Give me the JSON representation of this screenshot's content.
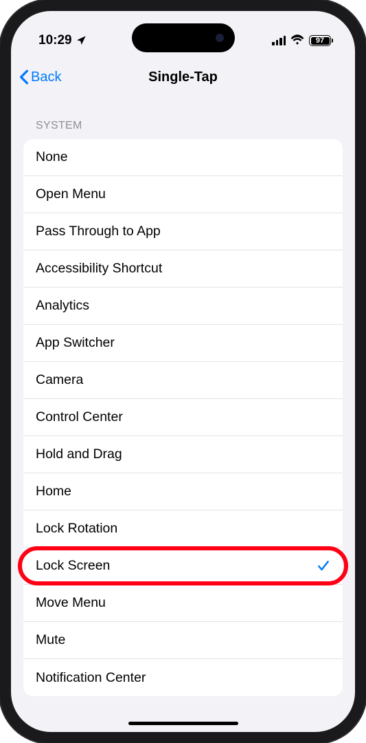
{
  "status_bar": {
    "time": "10:29",
    "battery_percent": "97"
  },
  "nav": {
    "back_label": "Back",
    "title": "Single-Tap"
  },
  "section": {
    "header": "SYSTEM",
    "items": [
      {
        "label": "None",
        "selected": false,
        "highlighted": false
      },
      {
        "label": "Open Menu",
        "selected": false,
        "highlighted": false
      },
      {
        "label": "Pass Through to App",
        "selected": false,
        "highlighted": false
      },
      {
        "label": "Accessibility Shortcut",
        "selected": false,
        "highlighted": false
      },
      {
        "label": "Analytics",
        "selected": false,
        "highlighted": false
      },
      {
        "label": "App Switcher",
        "selected": false,
        "highlighted": false
      },
      {
        "label": "Camera",
        "selected": false,
        "highlighted": false
      },
      {
        "label": "Control Center",
        "selected": false,
        "highlighted": false
      },
      {
        "label": "Hold and Drag",
        "selected": false,
        "highlighted": false
      },
      {
        "label": "Home",
        "selected": false,
        "highlighted": false
      },
      {
        "label": "Lock Rotation",
        "selected": false,
        "highlighted": false
      },
      {
        "label": "Lock Screen",
        "selected": true,
        "highlighted": true
      },
      {
        "label": "Move Menu",
        "selected": false,
        "highlighted": false
      },
      {
        "label": "Mute",
        "selected": false,
        "highlighted": false
      },
      {
        "label": "Notification Center",
        "selected": false,
        "highlighted": false
      }
    ]
  }
}
